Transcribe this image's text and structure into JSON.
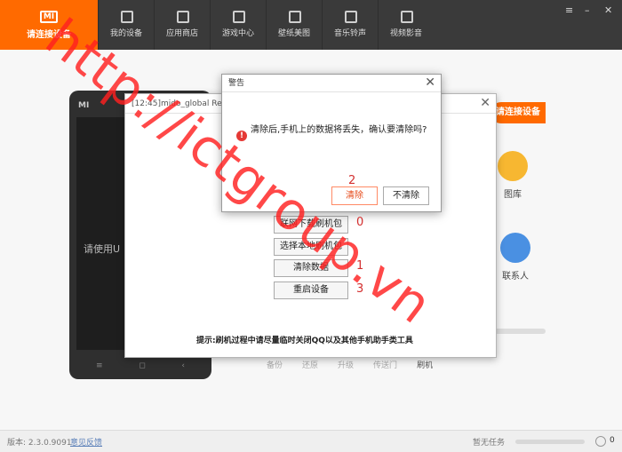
{
  "topbar": {
    "brand_logo": "MI",
    "brand_label": "请连接设备",
    "tabs": [
      {
        "label": "我的设备",
        "icon": "phone-icon"
      },
      {
        "label": "应用商店",
        "icon": "bag-icon"
      },
      {
        "label": "游戏中心",
        "icon": "gamepad-icon"
      },
      {
        "label": "壁纸美图",
        "icon": "image-icon"
      },
      {
        "label": "音乐铃声",
        "icon": "music-icon"
      },
      {
        "label": "视频影音",
        "icon": "video-icon"
      }
    ],
    "window_controls": [
      "≡",
      "–",
      "✕"
    ]
  },
  "background": {
    "phone_logo": "MI",
    "phone_hint": "请使用U",
    "phone_keys": [
      "≡",
      "◻",
      "‹"
    ],
    "connect_button": "请连接设备",
    "features": [
      {
        "label": "图库",
        "icon": "gallery-icon",
        "color": "#f7b731"
      },
      {
        "label": "联系人",
        "icon": "contacts-icon",
        "color": "#4a90e2"
      }
    ],
    "actions": [
      "备份",
      "还原",
      "升级",
      "传送门",
      "刷机"
    ]
  },
  "recovery_dialog": {
    "title": "[12:45]mido_global Recovery",
    "buttons": [
      "联网下载刷机包",
      "选择本地刷机包",
      "清除数据",
      "重启设备"
    ],
    "tip": "提示:刷机过程中请尽量临时关闭QQ以及其他手机助手类工具"
  },
  "warning_dialog": {
    "title": "警告",
    "icon": "!",
    "message": "清除后,手机上的数据将丢失，确认要清除吗?",
    "confirm": "清除",
    "cancel": "不清除"
  },
  "annotations": [
    "0",
    "1",
    "2",
    "3"
  ],
  "status": {
    "version": "版本: 2.3.0.9091",
    "feedback": "意见反馈",
    "tasks": "暂无任务",
    "count": "0"
  },
  "watermark": "http://ictgroup.vn",
  "colors": {
    "accent": "#ff6a00",
    "topbar": "#3a3a3a",
    "annotation": "#d32f2f"
  }
}
